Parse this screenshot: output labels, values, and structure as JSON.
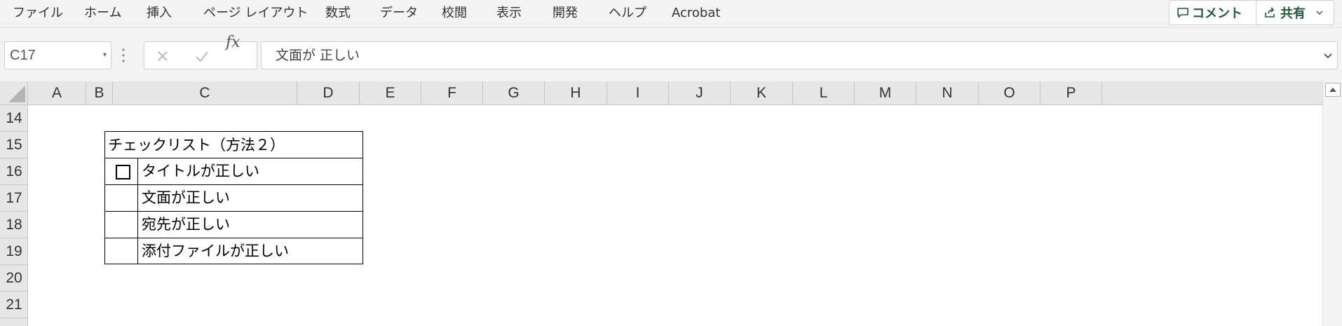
{
  "ribbon": {
    "tabs": [
      "ファイル",
      "ホーム",
      "挿入",
      "ページ レイアウト",
      "数式",
      "データ",
      "校閲",
      "表示",
      "開発",
      "ヘルプ",
      "Acrobat"
    ],
    "comment_label": "コメント",
    "share_label": "共有"
  },
  "formula_bar": {
    "name_box": "C17",
    "formula": "文面が 正しい"
  },
  "grid": {
    "columns": [
      "A",
      "B",
      "C",
      "D",
      "E",
      "F",
      "G",
      "H",
      "I",
      "J",
      "K",
      "L",
      "M",
      "N",
      "O",
      "P"
    ],
    "rows": [
      "14",
      "15",
      "16",
      "17",
      "18",
      "19",
      "20",
      "21"
    ]
  },
  "checklist": {
    "title": "チェックリスト（方法２）",
    "items": [
      "タイトルが正しい",
      "文面が正しい",
      "宛先が正しい",
      "添付ファイルが正しい"
    ]
  },
  "colors": {
    "ribbon_bg": "#f3f3f3",
    "header_bg": "#e6e6e6",
    "accent_green": "#1e5a35"
  }
}
